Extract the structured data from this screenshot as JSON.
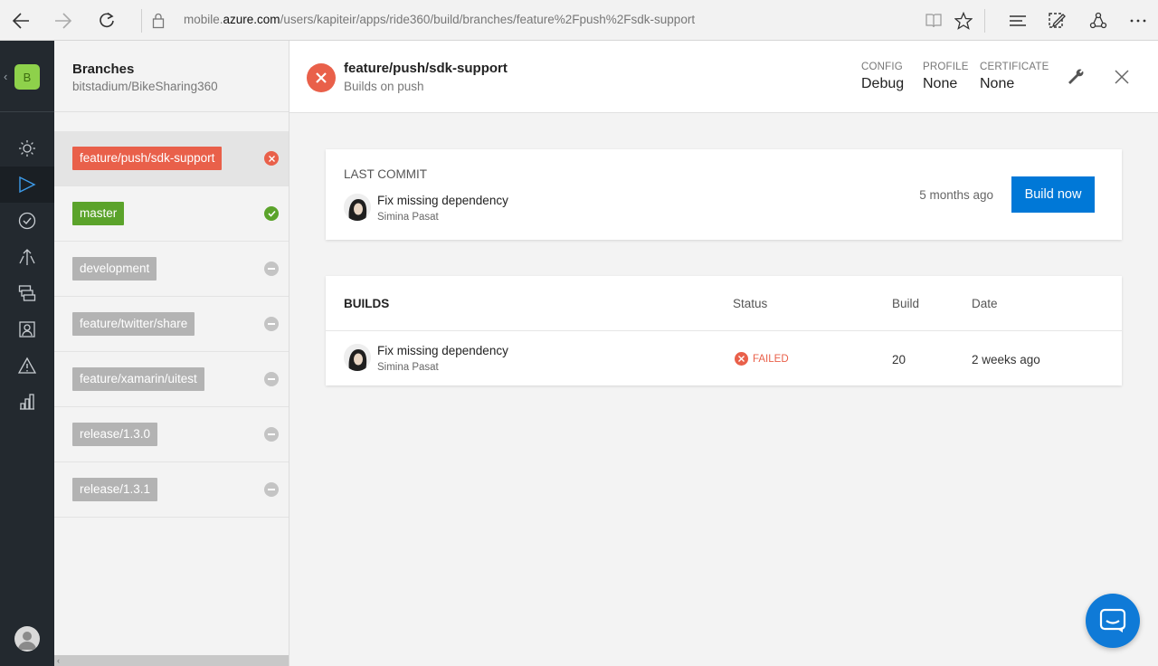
{
  "browser": {
    "url_prefix": "mobile.",
    "url_host": "azure.com",
    "url_path": "/users/kapiteir/apps/ride360/build/branches/feature%2Fpush%2Fsdk-support"
  },
  "app": {
    "initial": "B",
    "tile_color": "#8ed14b"
  },
  "branches_panel": {
    "title": "Branches",
    "subtitle": "bitstadium/BikeSharing360",
    "items": [
      {
        "label": "feature/push/sdk-support",
        "status": "failed",
        "tag_color": "#e9604a"
      },
      {
        "label": "master",
        "status": "succeeded",
        "tag_color": "#5ba32b"
      },
      {
        "label": "development",
        "status": "none",
        "tag_color": "#b3b3b3"
      },
      {
        "label": "feature/twitter/share",
        "status": "none",
        "tag_color": "#b3b3b3"
      },
      {
        "label": "feature/xamarin/uitest",
        "status": "none",
        "tag_color": "#b3b3b3"
      },
      {
        "label": "release/1.3.0",
        "status": "none",
        "tag_color": "#b3b3b3"
      },
      {
        "label": "release/1.3.1",
        "status": "none",
        "tag_color": "#b3b3b3"
      }
    ]
  },
  "header": {
    "branch": "feature/push/sdk-support",
    "trigger": "Builds on push",
    "config_label": "CONFIG",
    "config_value": "Debug",
    "profile_label": "PROFILE",
    "profile_value": "None",
    "certificate_label": "CERTIFICATE",
    "certificate_value": "None"
  },
  "last_commit": {
    "label": "LAST COMMIT",
    "message": "Fix missing dependency",
    "author": "Simina Pasat",
    "when": "5 months ago",
    "build_button": "Build now"
  },
  "builds": {
    "title": "BUILDS",
    "columns": {
      "status": "Status",
      "build": "Build",
      "date": "Date"
    },
    "rows": [
      {
        "message": "Fix missing dependency",
        "author": "Simina Pasat",
        "status": "FAILED",
        "build": "20",
        "date": "2 weeks ago"
      }
    ]
  },
  "colors": {
    "failed": "#e9604a",
    "success": "#5ba32b",
    "primary": "#0078d7",
    "rail": "#23292f"
  }
}
